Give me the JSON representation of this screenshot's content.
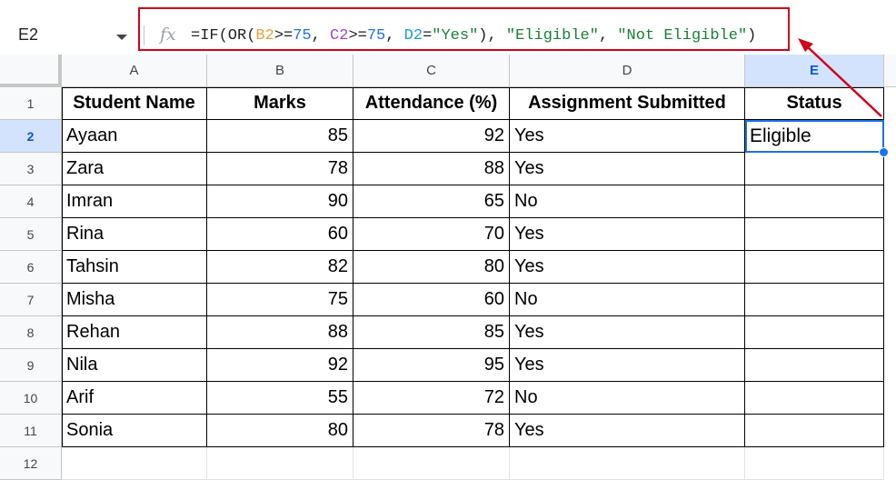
{
  "formula_bar": {
    "name_box": "E2",
    "fx_label": "fx",
    "formula_parts": [
      {
        "text": "=IF(OR(",
        "color": "#202124"
      },
      {
        "text": "B2",
        "color": "#e8a33d"
      },
      {
        "text": ">=",
        "color": "#202124"
      },
      {
        "text": "75",
        "color": "#1a73e8"
      },
      {
        "text": ", ",
        "color": "#202124"
      },
      {
        "text": "C2",
        "color": "#9c47c9"
      },
      {
        "text": ">=",
        "color": "#202124"
      },
      {
        "text": "75",
        "color": "#1a73e8"
      },
      {
        "text": ", ",
        "color": "#202124"
      },
      {
        "text": "D2",
        "color": "#12a4c7"
      },
      {
        "text": "=",
        "color": "#202124"
      },
      {
        "text": "\"Yes\"",
        "color": "#188038"
      },
      {
        "text": "), ",
        "color": "#202124"
      },
      {
        "text": "\"Eligible\"",
        "color": "#188038"
      },
      {
        "text": ", ",
        "color": "#202124"
      },
      {
        "text": "\"Not Eligible\"",
        "color": "#188038"
      },
      {
        "text": ")",
        "color": "#202124"
      }
    ]
  },
  "columns": [
    "A",
    "B",
    "C",
    "D",
    "E"
  ],
  "rows": [
    "1",
    "2",
    "3",
    "4",
    "5",
    "6",
    "7",
    "8",
    "9",
    "10",
    "11",
    "12"
  ],
  "table": {
    "headers": [
      "Student Name",
      "Marks",
      "Attendance (%)",
      "Assignment Submitted",
      "Status"
    ],
    "data": [
      [
        "Ayaan",
        "85",
        "92",
        "Yes",
        "Eligible"
      ],
      [
        "Zara",
        "78",
        "88",
        "Yes",
        ""
      ],
      [
        "Imran",
        "90",
        "65",
        "No",
        ""
      ],
      [
        "Rina",
        "60",
        "70",
        "Yes",
        ""
      ],
      [
        "Tahsin",
        "82",
        "80",
        "Yes",
        ""
      ],
      [
        "Misha",
        "75",
        "60",
        "No",
        ""
      ],
      [
        "Rehan",
        "88",
        "85",
        "Yes",
        ""
      ],
      [
        "Nila",
        "92",
        "95",
        "Yes",
        ""
      ],
      [
        "Arif",
        "55",
        "72",
        "No",
        ""
      ],
      [
        "Sonia",
        "80",
        "78",
        "Yes",
        ""
      ]
    ]
  },
  "selection": {
    "cell": "E2",
    "color": "#1a73e8"
  },
  "annotation": {
    "color": "#d0021b"
  }
}
